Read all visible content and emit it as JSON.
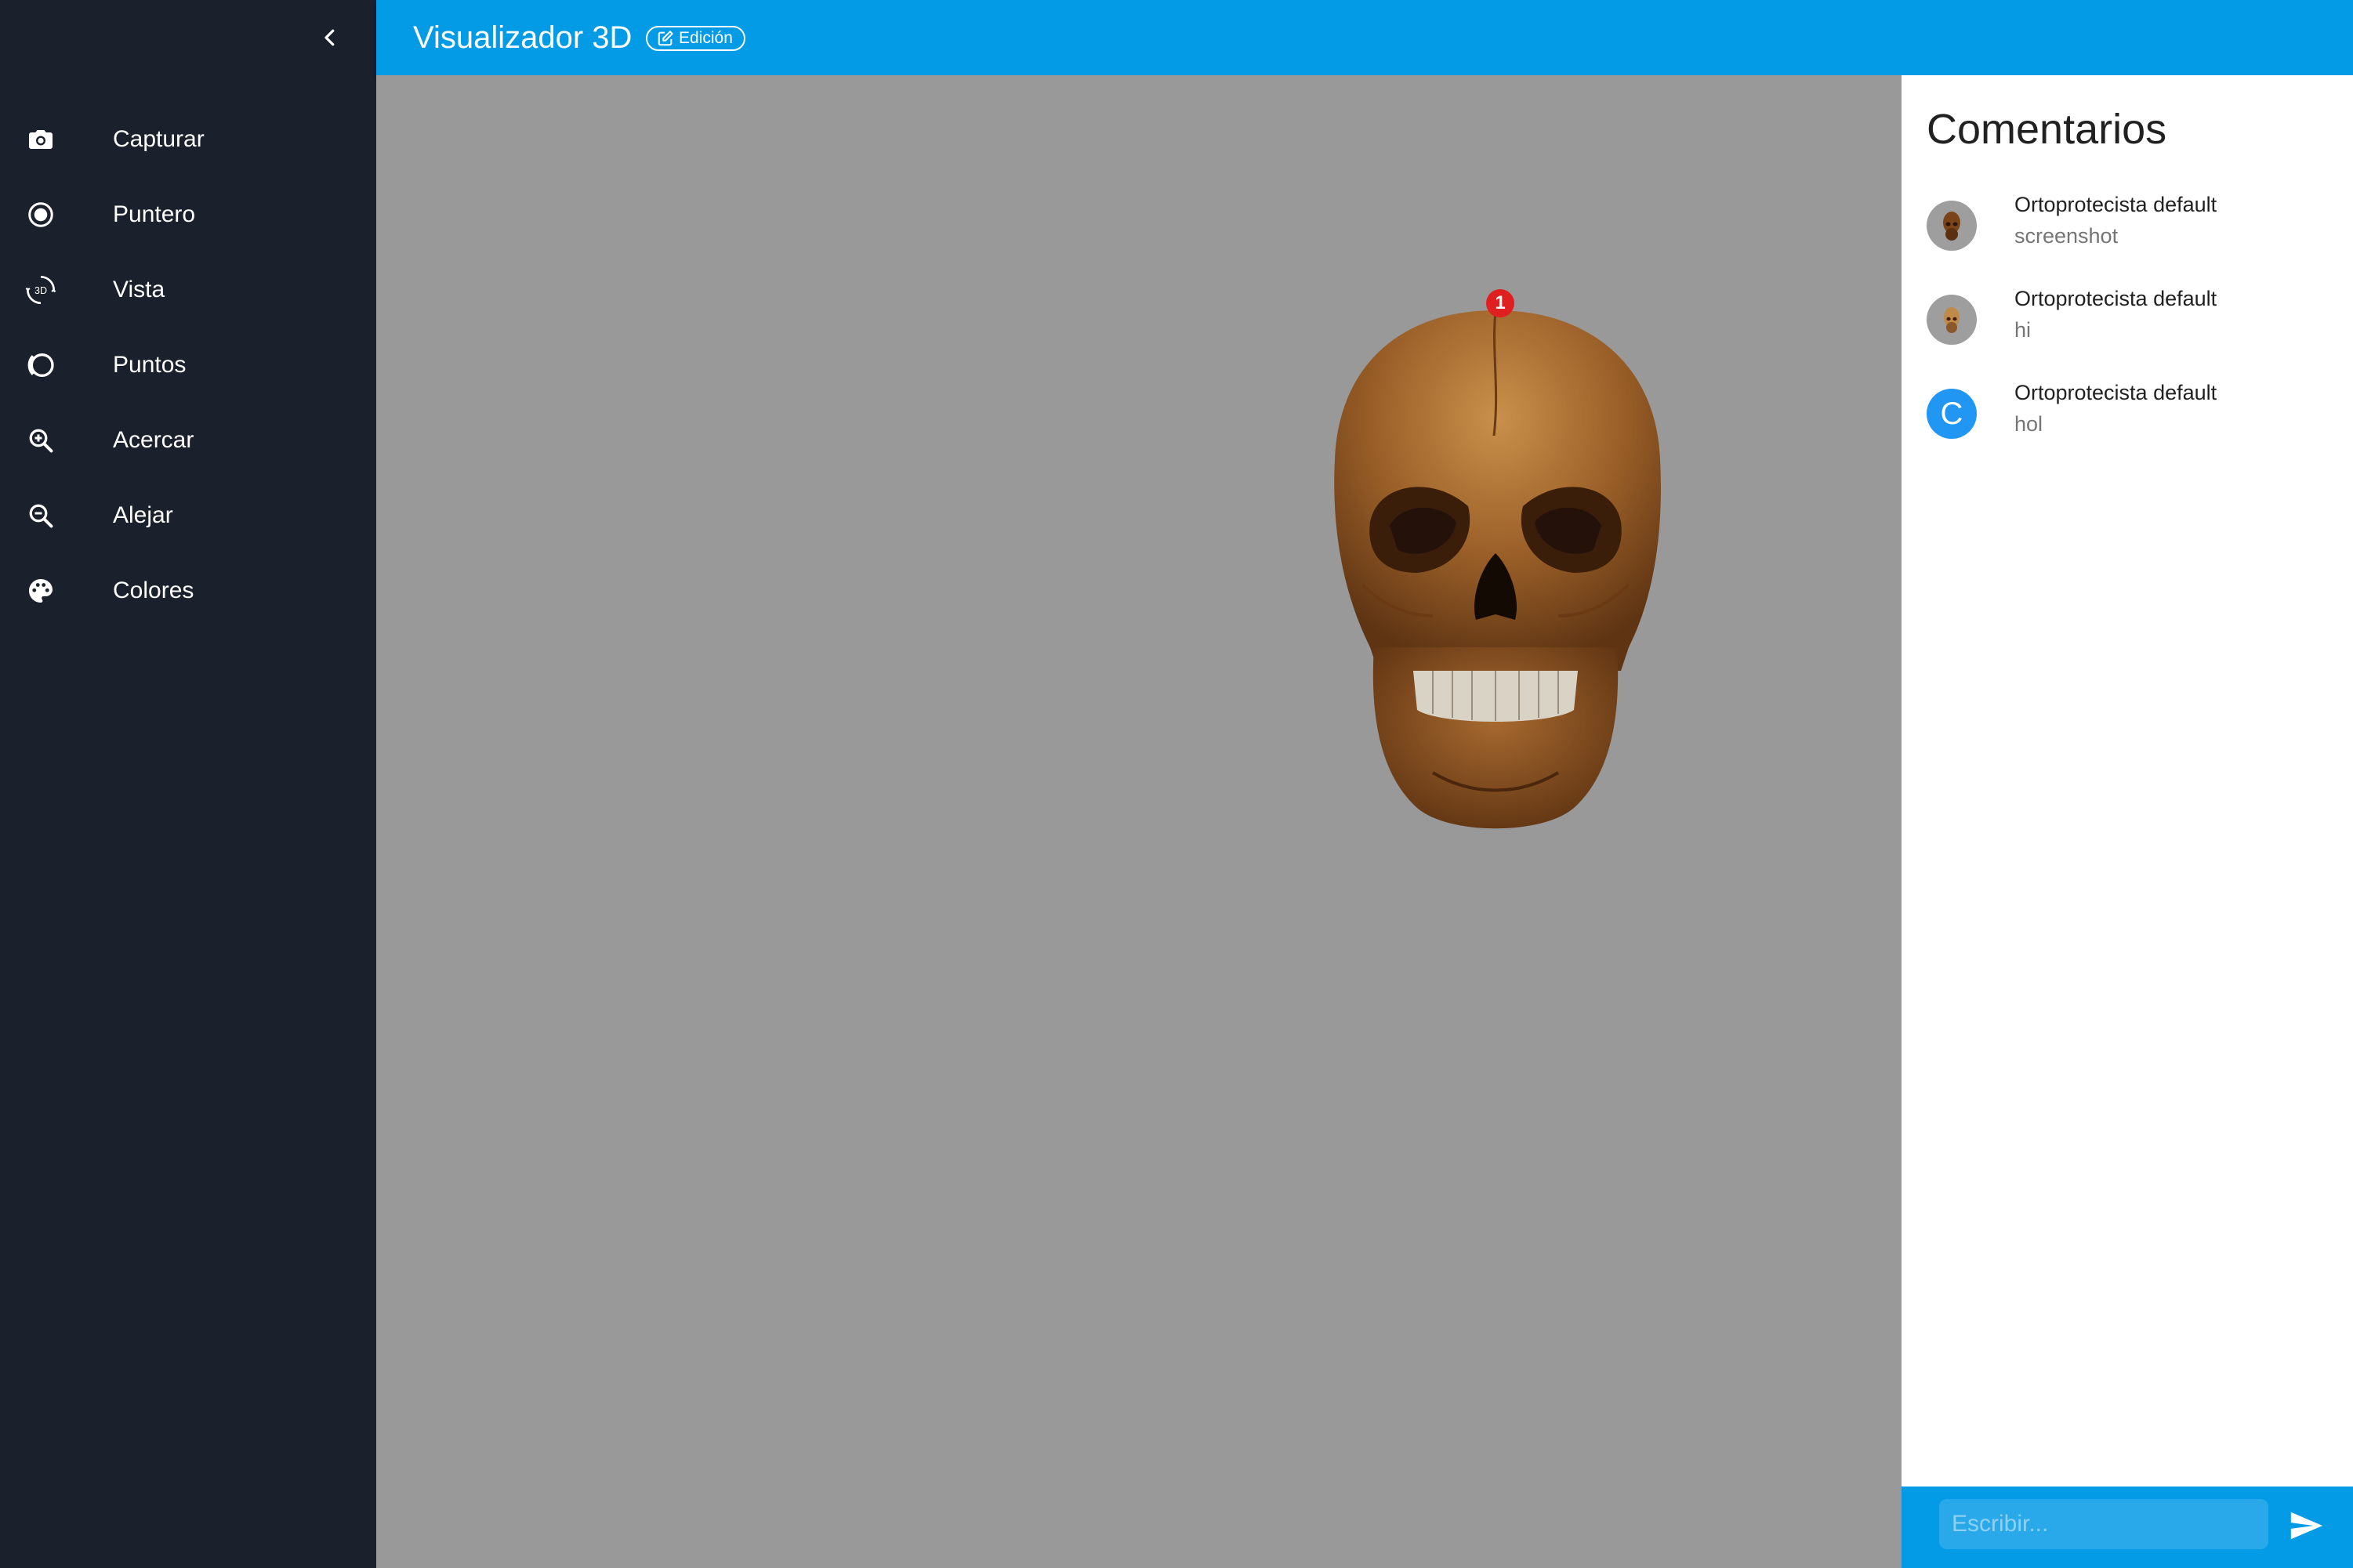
{
  "header": {
    "title": "Visualizador 3D",
    "badge": "Edición",
    "badge_icon": "edit-icon",
    "color": "#039be5"
  },
  "sidebar": {
    "collapse_icon": "chevron-left-icon",
    "items": [
      {
        "label": "Capturar",
        "icon": "camera-icon"
      },
      {
        "label": "Puntero",
        "icon": "radio-pointer-icon"
      },
      {
        "label": "Vista",
        "icon": "view-3d-rotate-icon",
        "icon_text": "3D"
      },
      {
        "label": "Puntos",
        "icon": "points-icon"
      },
      {
        "label": "Acercar",
        "icon": "zoom-in-icon"
      },
      {
        "label": "Alejar",
        "icon": "zoom-out-icon"
      },
      {
        "label": "Colores",
        "icon": "palette-icon"
      }
    ]
  },
  "viewer": {
    "marker_label": "1",
    "fab_icon": "chevron-right-icon"
  },
  "comments": {
    "title": "Comentarios",
    "items": [
      {
        "author": "Ortoprotecista default",
        "text": "screenshot",
        "avatar": "skull-thumbnail"
      },
      {
        "author": "Ortoprotecista default",
        "text": "hi",
        "avatar": "skull-thumbnail"
      },
      {
        "author": "Ortoprotecista default",
        "text": "hol",
        "avatar_letter": "C"
      }
    ],
    "input_placeholder": "Escribir...",
    "send_icon": "send-icon"
  }
}
